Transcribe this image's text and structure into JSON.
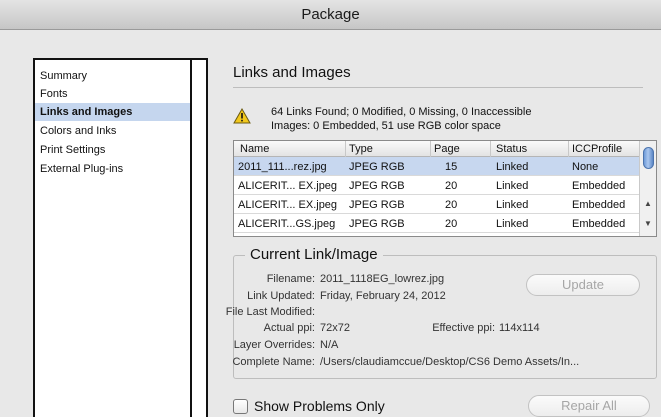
{
  "window": {
    "title": "Package"
  },
  "sidebar": {
    "items": [
      {
        "label": "Summary",
        "selected": false
      },
      {
        "label": "Fonts",
        "selected": false
      },
      {
        "label": "Links and Images",
        "selected": true
      },
      {
        "label": "Colors and Inks",
        "selected": false
      },
      {
        "label": "Print Settings",
        "selected": false
      },
      {
        "label": "External Plug-ins",
        "selected": false
      }
    ]
  },
  "links": {
    "heading": "Links and Images",
    "icon": "warning-triangle-icon",
    "summary_line_1": "64 Links Found; 0 Modified, 0 Missing, 0 Inaccessible",
    "summary_line_2": "Images: 0 Embedded, 51 use RGB color space",
    "table": {
      "columns": [
        "Name",
        "Type",
        "Page",
        "Status",
        "ICCProfile"
      ],
      "rows": [
        {
          "name": "2011_111...rez.jpg",
          "type": "JPEG RGB",
          "page": "15",
          "status": "Linked",
          "icc": "None",
          "selected": true
        },
        {
          "name": "ALICERIT... EX.jpeg",
          "type": "JPEG RGB",
          "page": "20",
          "status": "Linked",
          "icc": "Embedded",
          "selected": false
        },
        {
          "name": "ALICERIT... EX.jpeg",
          "type": "JPEG RGB",
          "page": "20",
          "status": "Linked",
          "icc": "Embedded",
          "selected": false
        },
        {
          "name": "ALICERIT...GS.jpeg",
          "type": "JPEG RGB",
          "page": "20",
          "status": "Linked",
          "icc": "Embedded",
          "selected": false
        }
      ]
    }
  },
  "current_link": {
    "heading": "Current Link/Image",
    "filename_label": "Filename:",
    "filename": "2011_1118EG_lowrez.jpg",
    "link_updated_label": "Link Updated:",
    "link_updated": "Friday, February 24, 2012",
    "file_last_modified_label": "File Last Modified:",
    "actual_ppi_label": "Actual ppi:",
    "actual_ppi": "72x72",
    "effective_ppi_label": "Effective ppi:",
    "effective_ppi": "114x114",
    "layer_overrides_label": "Layer Overrides:",
    "layer_overrides": "N/A",
    "complete_name_label": "Complete Name:",
    "complete_name": "/Users/claudiamccue/Desktop/CS6 Demo Assets/In...",
    "update_label": "Update"
  },
  "footer": {
    "show_problems_label": "Show Problems Only",
    "show_problems_checked": false,
    "repair_all_label": "Repair All"
  }
}
